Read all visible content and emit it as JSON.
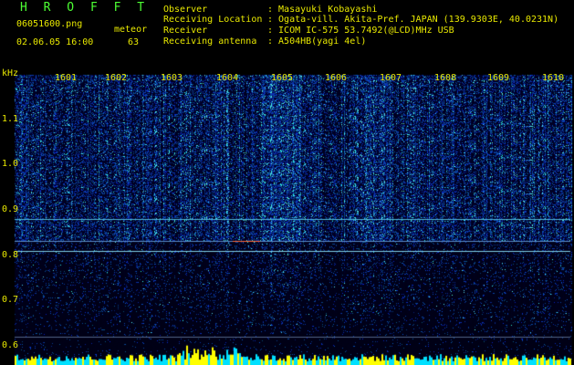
{
  "header": {
    "title": "H R O F F T",
    "filename": "06051600.png",
    "datetime": "02.06.05 16:00",
    "meteor_label": "meteor",
    "meteor_count": "63"
  },
  "info": [
    {
      "label": "Observer",
      "value": ": Masayuki Kobayashi"
    },
    {
      "label": "Receiving Location",
      "value": ": Ogata-vill. Akita-Pref. JAPAN (139.9303E, 40.0231N)"
    },
    {
      "label": "Receiver",
      "value": ": ICOM IC-575 53.7492(@LCD)MHz USB"
    },
    {
      "label": "Receiving antenna",
      "value": ": A504HB(yagi 4el)"
    }
  ],
  "axis": {
    "y_unit": "kHz",
    "y_ticks": [
      "1.1",
      "1.0",
      "0.9",
      "0.8",
      "0.7",
      "0.6"
    ],
    "x_ticks": [
      "1601",
      "1602",
      "1603",
      "1604",
      "1605",
      "1606",
      "1607",
      "1608",
      "1609",
      "1610"
    ]
  },
  "colors": {
    "text": "#e8e800",
    "title": "#4dff33",
    "background": "#000000",
    "spectrum_base": "#0a1a7a",
    "spectrum_hot": "#33ffcc",
    "bars_yellow": "#ffff00",
    "bars_cyan": "#00e0ff"
  }
}
